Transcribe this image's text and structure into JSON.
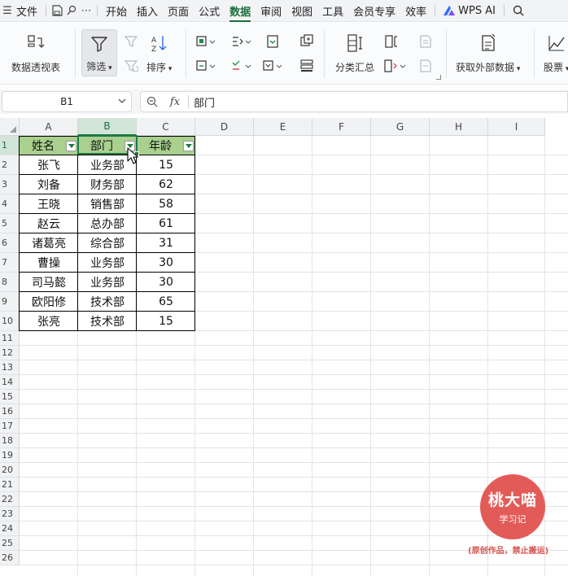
{
  "menubar": {
    "file": "文件",
    "tabs": [
      "开始",
      "插入",
      "页面",
      "公式",
      "数据",
      "审阅",
      "视图",
      "工具",
      "会员专享",
      "效率"
    ],
    "active_tab": "数据",
    "wps_ai": "WPS AI"
  },
  "ribbon": {
    "pivot": "数据透视表",
    "filter": "筛选",
    "sort": "排序",
    "subtotal": "分类汇总",
    "external": "获取外部数据",
    "stock": "股票"
  },
  "formula_bar": {
    "name_box": "B1",
    "fx": "fx",
    "content": "部门"
  },
  "sheet": {
    "columns": [
      "A",
      "B",
      "C",
      "D",
      "E",
      "F",
      "G",
      "H",
      "I"
    ],
    "rows": [
      "1",
      "2",
      "3",
      "4",
      "5",
      "6",
      "7",
      "8",
      "9",
      "10",
      "11",
      "12",
      "13",
      "14",
      "15",
      "16",
      "17",
      "18",
      "19",
      "20",
      "21",
      "22",
      "23",
      "24",
      "25",
      "26"
    ],
    "selected_column": "B",
    "selected_row": "1",
    "table": {
      "headers": [
        "姓名",
        "部门",
        "年龄"
      ],
      "rows": [
        [
          "张飞",
          "业务部",
          "15"
        ],
        [
          "刘备",
          "财务部",
          "62"
        ],
        [
          "王晓",
          "销售部",
          "58"
        ],
        [
          "赵云",
          "总办部",
          "61"
        ],
        [
          "诸葛亮",
          "综合部",
          "31"
        ],
        [
          "曹操",
          "业务部",
          "30"
        ],
        [
          "司马懿",
          "业务部",
          "30"
        ],
        [
          "欧阳修",
          "技术部",
          "65"
        ],
        [
          "张亮",
          "技术部",
          "15"
        ]
      ]
    }
  },
  "watermark": {
    "title": "桃大喵",
    "subtitle": "学习记",
    "note": "(原创作品，禁止搬运)"
  },
  "colors": {
    "accent": "#1a6e3c",
    "header_fill": "#a9d08e",
    "watermark": "#e35b57"
  }
}
